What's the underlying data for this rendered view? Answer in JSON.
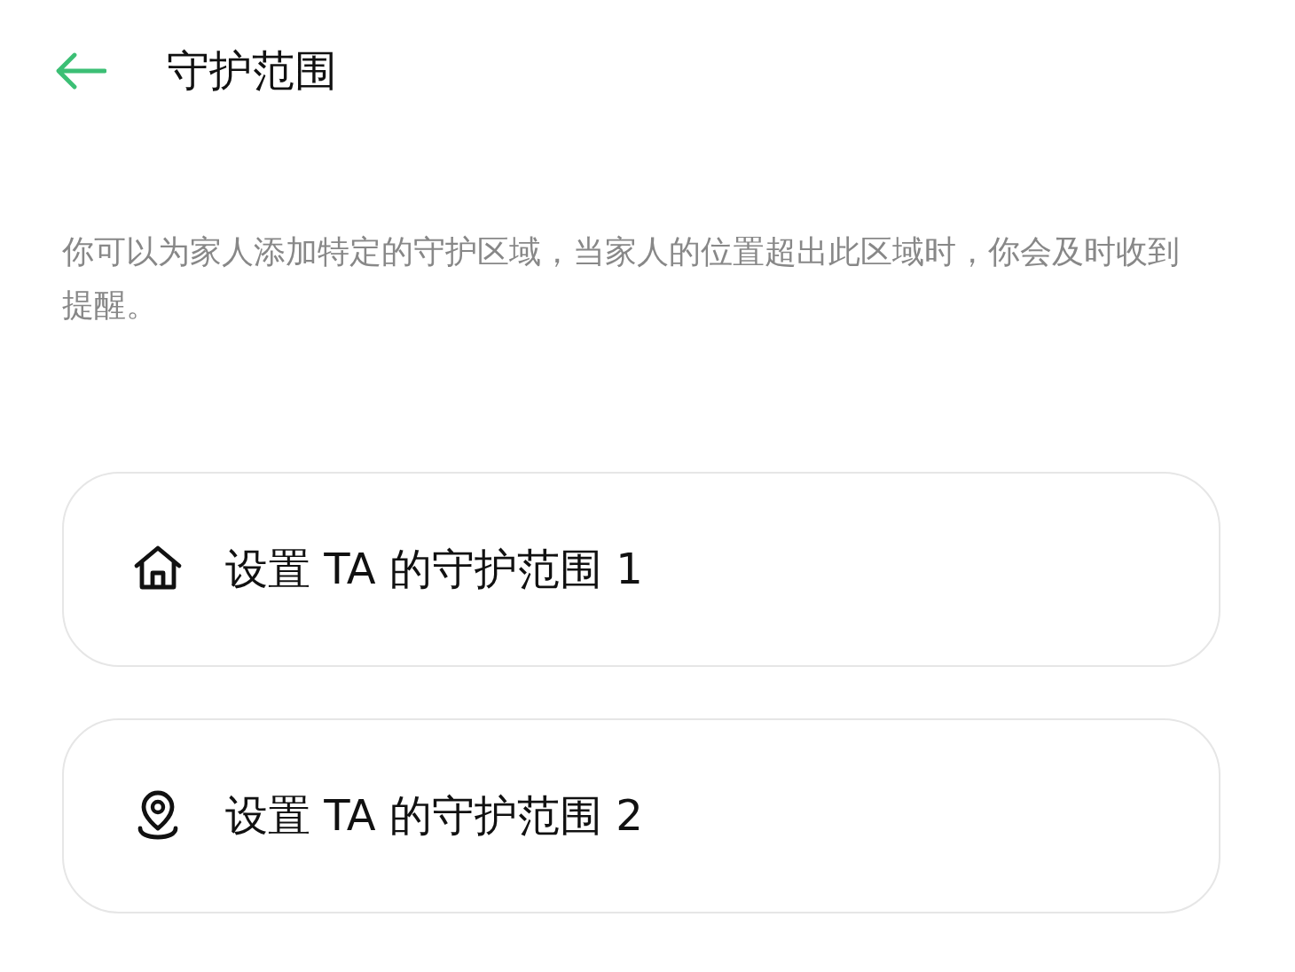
{
  "header": {
    "title": "守护范围"
  },
  "description": "你可以为家人添加特定的守护区域，当家人的位置超出此区域时，你会及时收到提醒。",
  "zones": [
    {
      "kind": "home",
      "label": "设置 TA 的守护范围 1"
    },
    {
      "kind": "location",
      "label": "设置 TA 的守护范围 2"
    }
  ]
}
